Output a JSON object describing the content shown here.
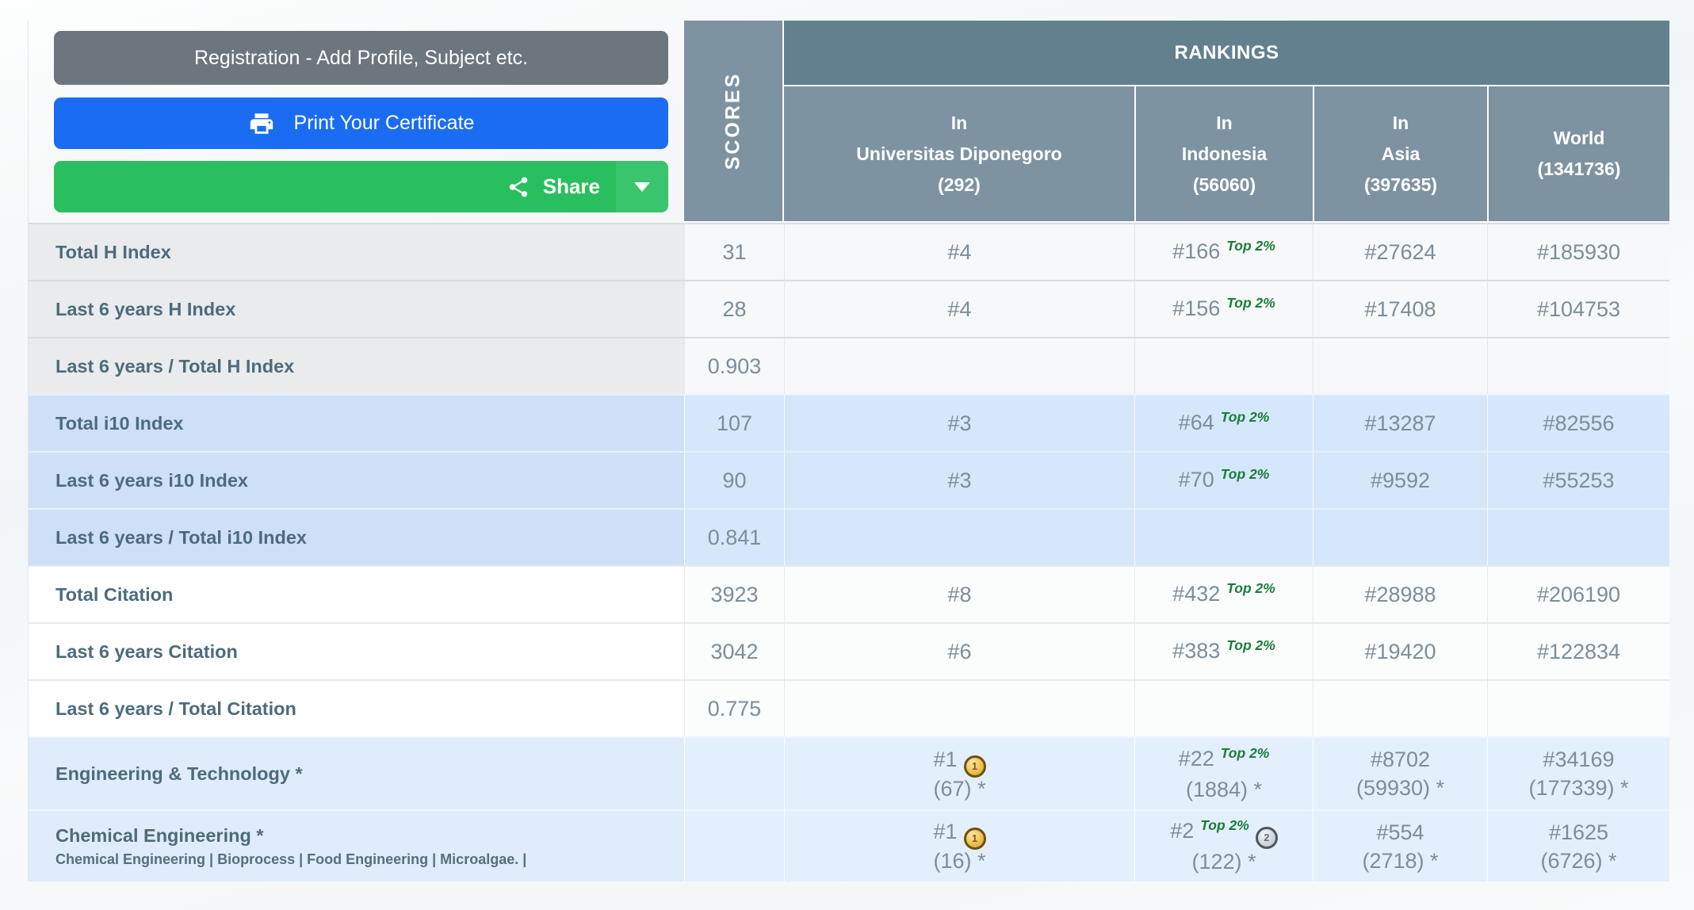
{
  "buttons": {
    "registration_label": "Registration - Add Profile, Subject etc.",
    "print_label": "Print Your Certificate",
    "share_label": "Share"
  },
  "colors": {
    "button_gray": "#6d757d",
    "button_blue": "#1a6df3",
    "button_green": "#2abf5e",
    "header_band": "#63808f",
    "header_cell": "#7e93a1",
    "top2_green": "#1b7c3b",
    "label_text": "#4d6b7c",
    "value_text": "#7b8e9a",
    "medal_gold": "#eec04f",
    "medal_silver": "#d3d7db"
  },
  "table": {
    "scores_header": "SCORES",
    "rankings_header": "RANKINGS",
    "top2_label": "Top 2%",
    "columns": [
      {
        "lines": [
          "In",
          "Universitas Diponegoro",
          "(292)"
        ]
      },
      {
        "lines": [
          "In",
          "Indonesia",
          "(56060)"
        ]
      },
      {
        "lines": [
          "In",
          "Asia",
          "(397635)"
        ]
      },
      {
        "lines": [
          "World",
          "(1341736)"
        ]
      }
    ],
    "rows": [
      {
        "label": "Total H Index",
        "tone": "gray",
        "score": "31",
        "cells": [
          {
            "rank": "#4"
          },
          {
            "rank": "#166",
            "top2": true
          },
          {
            "rank": "#27624"
          },
          {
            "rank": "#185930"
          }
        ]
      },
      {
        "label": "Last 6 years H Index",
        "tone": "gray",
        "score": "28",
        "cells": [
          {
            "rank": "#4"
          },
          {
            "rank": "#156",
            "top2": true
          },
          {
            "rank": "#17408"
          },
          {
            "rank": "#104753"
          }
        ]
      },
      {
        "label": "Last 6 years / Total H Index",
        "tone": "gray",
        "score": "0.903",
        "cells": [
          null,
          null,
          null,
          null
        ]
      },
      {
        "label": "Total i10 Index",
        "tone": "blue",
        "score": "107",
        "cells": [
          {
            "rank": "#3"
          },
          {
            "rank": "#64",
            "top2": true
          },
          {
            "rank": "#13287"
          },
          {
            "rank": "#82556"
          }
        ]
      },
      {
        "label": "Last 6 years i10 Index",
        "tone": "blue",
        "score": "90",
        "cells": [
          {
            "rank": "#3"
          },
          {
            "rank": "#70",
            "top2": true
          },
          {
            "rank": "#9592"
          },
          {
            "rank": "#55253"
          }
        ]
      },
      {
        "label": "Last 6 years / Total i10 Index",
        "tone": "blue",
        "score": "0.841",
        "cells": [
          null,
          null,
          null,
          null
        ]
      },
      {
        "label": "Total Citation",
        "tone": "white",
        "score": "3923",
        "cells": [
          {
            "rank": "#8"
          },
          {
            "rank": "#432",
            "top2": true
          },
          {
            "rank": "#28988"
          },
          {
            "rank": "#206190"
          }
        ]
      },
      {
        "label": "Last 6 years Citation",
        "tone": "white",
        "score": "3042",
        "cells": [
          {
            "rank": "#6"
          },
          {
            "rank": "#383",
            "top2": true
          },
          {
            "rank": "#19420"
          },
          {
            "rank": "#122834"
          }
        ]
      },
      {
        "label": "Last 6 years / Total Citation",
        "tone": "white",
        "score": "0.775",
        "cells": [
          null,
          null,
          null,
          null
        ]
      },
      {
        "label": "Engineering & Technology *",
        "tone": "subject",
        "score": "",
        "cells": [
          {
            "rank": "#1",
            "medal": "gold",
            "medal_text": "1",
            "sub": "(67) *"
          },
          {
            "rank": "#22",
            "top2": true,
            "sub": "(1884) *"
          },
          {
            "rank": "#8702",
            "sub": "(59930) *"
          },
          {
            "rank": "#34169",
            "sub": "(177339) *"
          }
        ]
      },
      {
        "label": "Chemical Engineering *",
        "sublabel": "Chemical Engineering | Bioprocess | Food Engineering | Microalgae. |",
        "tone": "subject",
        "score": "",
        "cells": [
          {
            "rank": "#1",
            "medal": "gold",
            "medal_text": "1",
            "sub": "(16) *"
          },
          {
            "rank": "#2",
            "top2": true,
            "medal": "silver",
            "medal_text": "2",
            "sub": "(122) *"
          },
          {
            "rank": "#554",
            "sub": "(2718) *"
          },
          {
            "rank": "#1625",
            "sub": "(6726) *"
          }
        ]
      }
    ]
  }
}
